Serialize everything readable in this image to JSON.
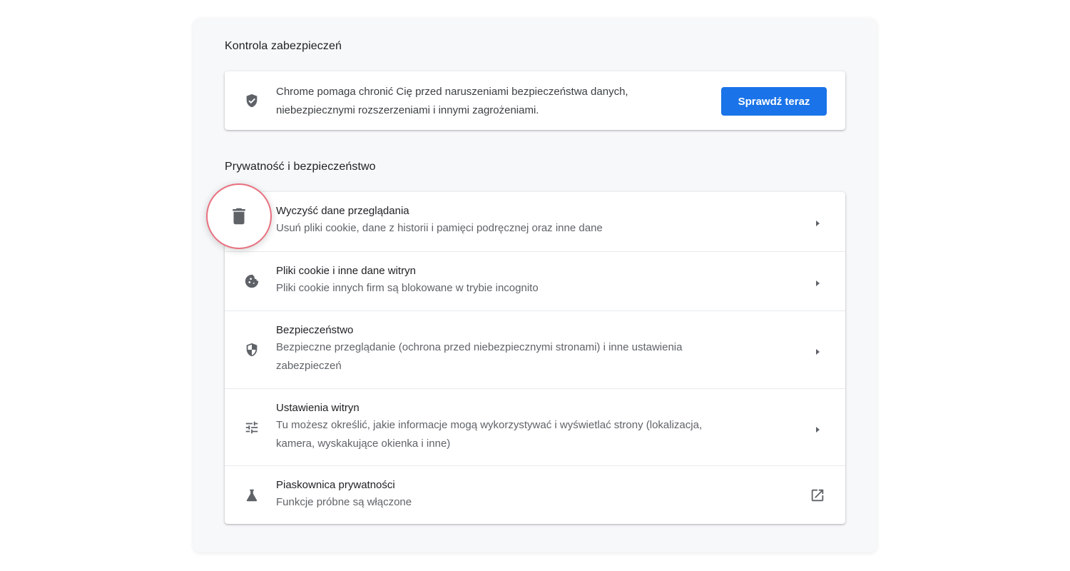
{
  "safety_check": {
    "section_title": "Kontrola zabezpieczeń",
    "description_line1": "Chrome pomaga chronić Cię przed naruszeniami bezpieczeństwa danych,",
    "description_line2": "niebezpiecznymi rozszerzeniami i innymi zagrożeniami.",
    "button_label": "Sprawdź teraz",
    "icon": "shield-check-icon"
  },
  "privacy": {
    "section_title": "Prywatność i bezpieczeństwo",
    "items": [
      {
        "title": "Wyczyść dane przeglądania",
        "subtitle": "Usuń pliki cookie, dane z historii i pamięci podręcznej oraz inne dane",
        "icon": "trash-icon",
        "action": "chevron-right-icon"
      },
      {
        "title": "Pliki cookie i inne dane witryn",
        "subtitle": "Pliki cookie innych firm są blokowane w trybie incognito",
        "icon": "cookie-icon",
        "action": "chevron-right-icon"
      },
      {
        "title": "Bezpieczeństwo",
        "subtitle_line1": "Bezpieczne przeglądanie (ochrona przed niebezpiecznymi stronami) i inne ustawienia",
        "subtitle_line2": "zabezpieczeń",
        "icon": "shield-icon",
        "action": "chevron-right-icon"
      },
      {
        "title": "Ustawienia witryn",
        "subtitle_line1": "Tu możesz określić, jakie informacje mogą wykorzystywać i wyświetlać strony (lokalizacja,",
        "subtitle_line2": "kamera, wyskakujące okienka i inne)",
        "icon": "tune-icon",
        "action": "chevron-right-icon"
      },
      {
        "title": "Piaskownica prywatności",
        "subtitle": "Funkcje próbne są włączone",
        "icon": "flask-icon",
        "action": "open-in-new-icon"
      }
    ]
  },
  "colors": {
    "accent": "#1a73e8",
    "highlight_ring": "#e8707f",
    "panel_bg": "#f7f8fa"
  }
}
